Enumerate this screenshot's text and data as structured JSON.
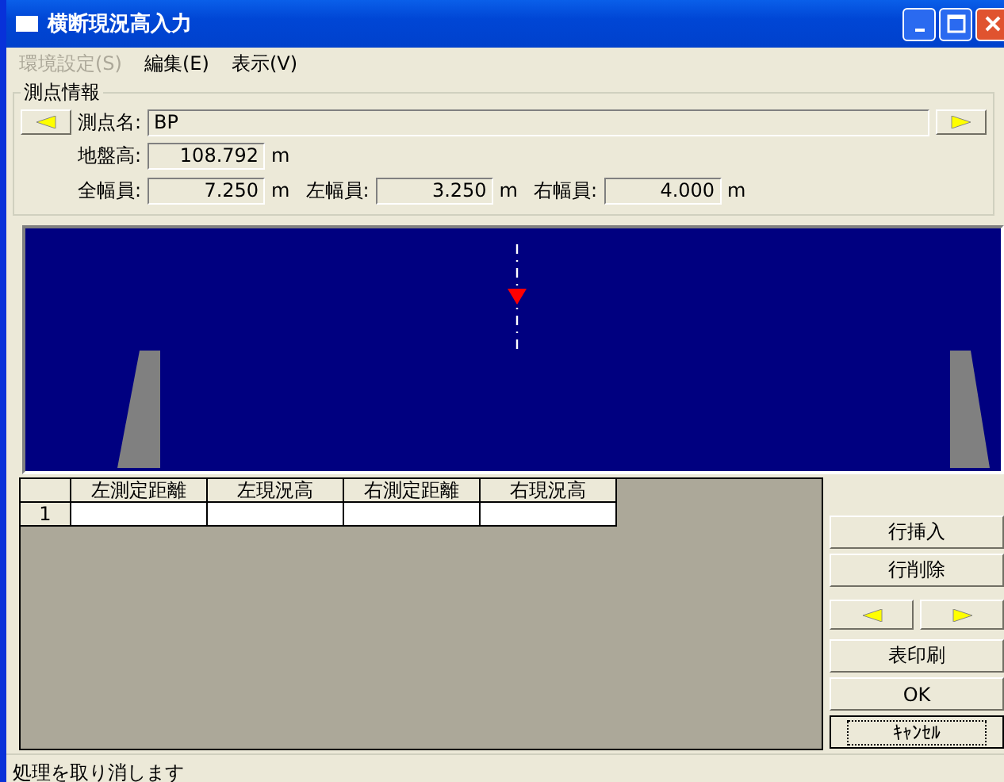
{
  "window": {
    "title": "横断現況高入力"
  },
  "menu": [
    {
      "label": "環境設定(S)",
      "disabled": true
    },
    {
      "label": "編集(E)",
      "disabled": false
    },
    {
      "label": "表示(V)",
      "disabled": false
    }
  ],
  "station_info": {
    "legend": "測点情報",
    "name_label": "測点名:",
    "name_value": "BP",
    "fields": [
      {
        "label": "地盤高:",
        "value": "108.792",
        "unit": "m"
      }
    ],
    "widths": [
      {
        "label": "全幅員:",
        "value": "7.250",
        "unit": "m"
      },
      {
        "label": "左幅員:",
        "value": "3.250",
        "unit": "m"
      },
      {
        "label": "右幅員:",
        "value": "4.000",
        "unit": "m"
      }
    ]
  },
  "table": {
    "columns": [
      "左測定距離",
      "左現況高",
      "右測定距離",
      "右現況高"
    ],
    "rows": [
      {
        "header": "1"
      }
    ]
  },
  "buttons": [
    {
      "kind": "text",
      "label": "行挿入",
      "focused": false
    },
    {
      "kind": "text",
      "label": "行削除",
      "focused": false
    },
    {
      "kind": "arrows",
      "focused": false
    },
    {
      "kind": "text",
      "label": "表印刷",
      "focused": false
    },
    {
      "kind": "text",
      "label": "OK",
      "focused": false
    },
    {
      "kind": "text",
      "label": "ｷｬﾝｾﾙ",
      "focused": true
    }
  ],
  "status_bar": "処理を取り消します"
}
